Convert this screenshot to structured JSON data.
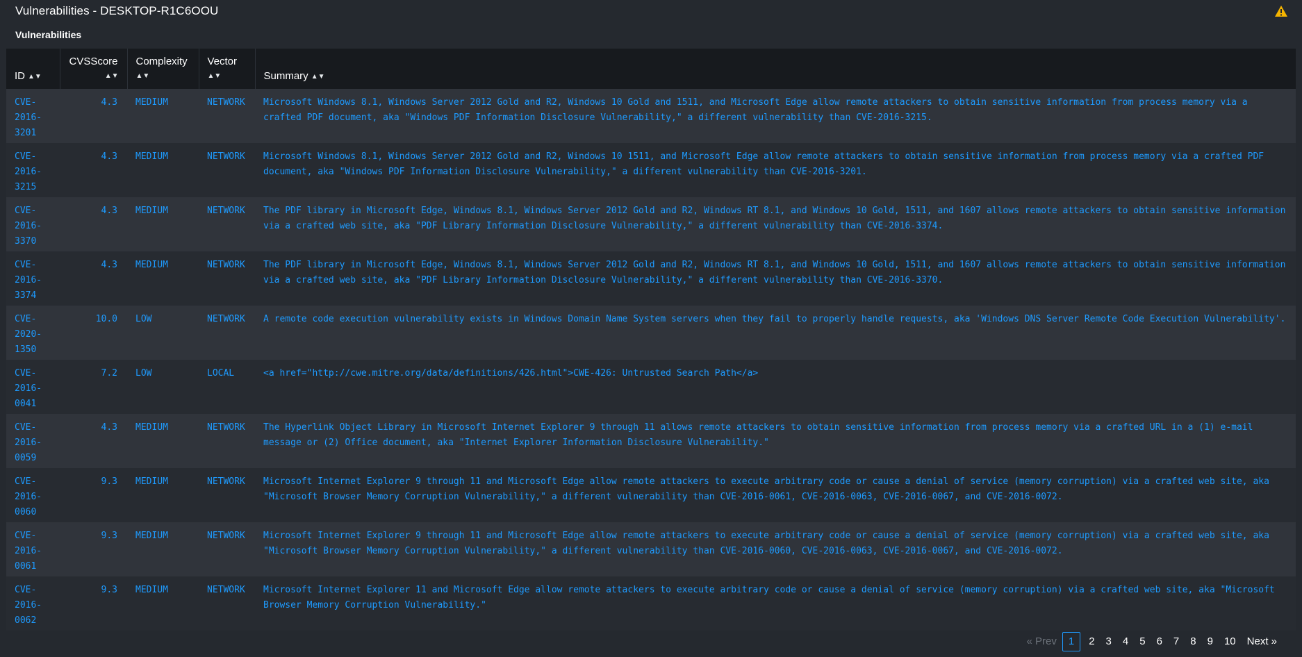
{
  "header": {
    "title": "Vulnerabilities - DESKTOP-R1C6OOU",
    "warning_icon": "warning-icon"
  },
  "subtitle": "Vulnerabilities",
  "columns": {
    "id": "ID",
    "cvss": "CVSScore",
    "complexity": "Complexity",
    "vector": "Vector",
    "summary": "Summary"
  },
  "rows": [
    {
      "id": "CVE-2016-3201",
      "score": "4.3",
      "complexity": "MEDIUM",
      "vector": "NETWORK",
      "summary": "Microsoft Windows 8.1, Windows Server 2012 Gold and R2, Windows 10 Gold and 1511, and Microsoft Edge allow remote attackers to obtain sensitive information from process memory via a crafted PDF document, aka \"Windows PDF Information Disclosure Vulnerability,\" a different vulnerability than CVE-2016-3215."
    },
    {
      "id": "CVE-2016-3215",
      "score": "4.3",
      "complexity": "MEDIUM",
      "vector": "NETWORK",
      "summary": "Microsoft Windows 8.1, Windows Server 2012 Gold and R2, Windows 10 1511, and Microsoft Edge allow remote attackers to obtain sensitive information from process memory via a crafted PDF document, aka \"Windows PDF Information Disclosure Vulnerability,\" a different vulnerability than CVE-2016-3201."
    },
    {
      "id": "CVE-2016-3370",
      "score": "4.3",
      "complexity": "MEDIUM",
      "vector": "NETWORK",
      "summary": "The PDF library in Microsoft Edge, Windows 8.1, Windows Server 2012 Gold and R2, Windows RT 8.1, and Windows 10 Gold, 1511, and 1607 allows remote attackers to obtain sensitive information via a crafted web site, aka \"PDF Library Information Disclosure Vulnerability,\" a different vulnerability than CVE-2016-3374."
    },
    {
      "id": "CVE-2016-3374",
      "score": "4.3",
      "complexity": "MEDIUM",
      "vector": "NETWORK",
      "summary": "The PDF library in Microsoft Edge, Windows 8.1, Windows Server 2012 Gold and R2, Windows RT 8.1, and Windows 10 Gold, 1511, and 1607 allows remote attackers to obtain sensitive information via a crafted web site, aka \"PDF Library Information Disclosure Vulnerability,\" a different vulnerability than CVE-2016-3370."
    },
    {
      "id": "CVE-2020-1350",
      "score": "10.0",
      "complexity": "LOW",
      "vector": "NETWORK",
      "summary": "A remote code execution vulnerability exists in Windows Domain Name System servers when they fail to properly handle requests, aka 'Windows DNS Server Remote Code Execution Vulnerability'."
    },
    {
      "id": "CVE-2016-0041",
      "score": "7.2",
      "complexity": "LOW",
      "vector": "LOCAL",
      "summary": "<a href=\"http://cwe.mitre.org/data/definitions/426.html\">CWE-426: Untrusted Search Path</a>"
    },
    {
      "id": "CVE-2016-0059",
      "score": "4.3",
      "complexity": "MEDIUM",
      "vector": "NETWORK",
      "summary": "The Hyperlink Object Library in Microsoft Internet Explorer 9 through 11 allows remote attackers to obtain sensitive information from process memory via a crafted URL in a (1) e-mail message or (2) Office document, aka \"Internet Explorer Information Disclosure Vulnerability.\""
    },
    {
      "id": "CVE-2016-0060",
      "score": "9.3",
      "complexity": "MEDIUM",
      "vector": "NETWORK",
      "summary": "Microsoft Internet Explorer 9 through 11 and Microsoft Edge allow remote attackers to execute arbitrary code or cause a denial of service (memory corruption) via a crafted web site, aka \"Microsoft Browser Memory Corruption Vulnerability,\" a different vulnerability than CVE-2016-0061, CVE-2016-0063, CVE-2016-0067, and CVE-2016-0072."
    },
    {
      "id": "CVE-2016-0061",
      "score": "9.3",
      "complexity": "MEDIUM",
      "vector": "NETWORK",
      "summary": "Microsoft Internet Explorer 9 through 11 and Microsoft Edge allow remote attackers to execute arbitrary code or cause a denial of service (memory corruption) via a crafted web site, aka \"Microsoft Browser Memory Corruption Vulnerability,\" a different vulnerability than CVE-2016-0060, CVE-2016-0063, CVE-2016-0067, and CVE-2016-0072."
    },
    {
      "id": "CVE-2016-0062",
      "score": "9.3",
      "complexity": "MEDIUM",
      "vector": "NETWORK",
      "summary": "Microsoft Internet Explorer 11 and Microsoft Edge allow remote attackers to execute arbitrary code or cause a denial of service (memory corruption) via a crafted web site, aka \"Microsoft Browser Memory Corruption Vulnerability.\""
    }
  ],
  "pagination": {
    "prev": "« Prev",
    "pages": [
      "1",
      "2",
      "3",
      "4",
      "5",
      "6",
      "7",
      "8",
      "9",
      "10"
    ],
    "current": "1",
    "next": "Next »"
  },
  "colors": {
    "link": "#1e9bff",
    "header_bg": "#171a1e",
    "row_odd": "#30343b",
    "row_even": "#272b31",
    "warning": "#f5b400"
  }
}
